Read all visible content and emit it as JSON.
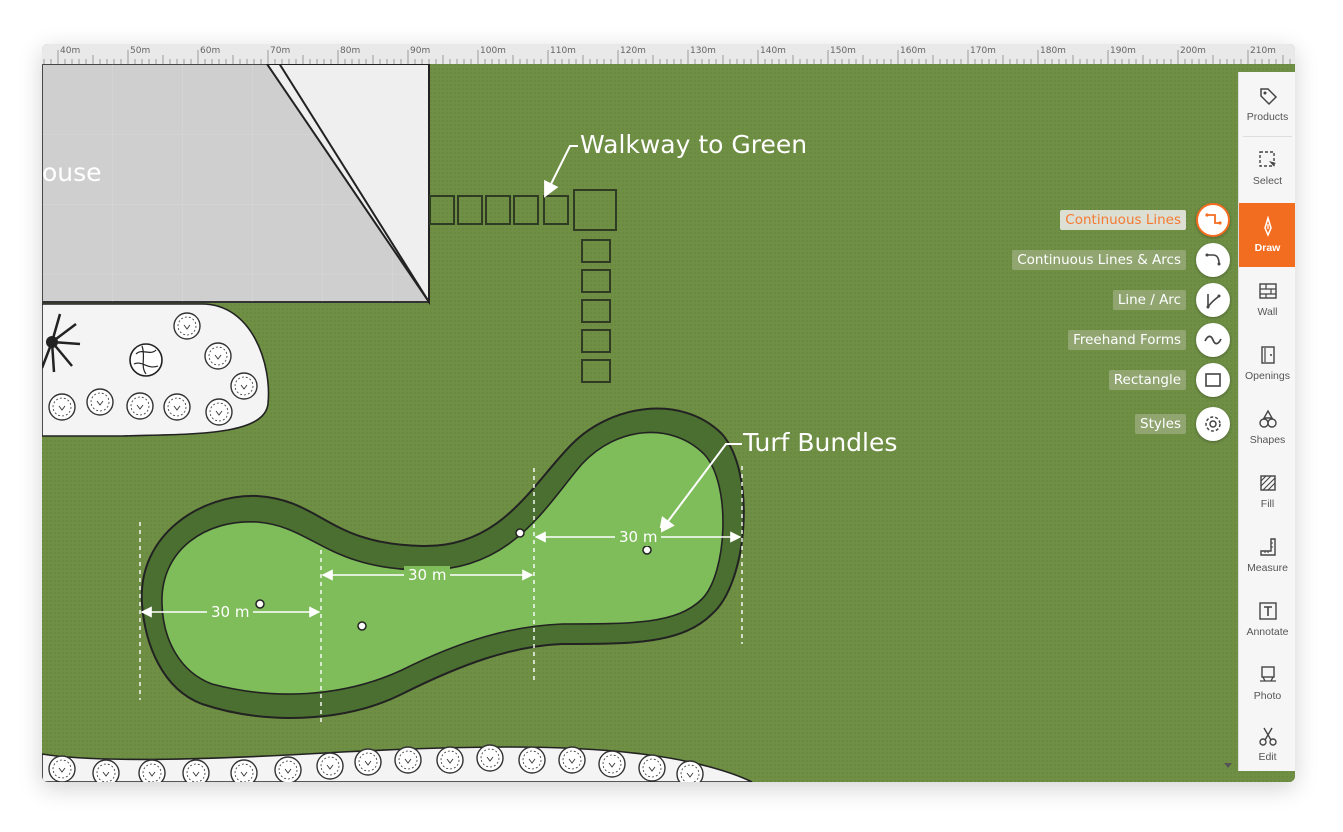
{
  "ruler": {
    "ticks": [
      "40m",
      "50m",
      "60m",
      "70m",
      "80m",
      "90m",
      "100m",
      "110m",
      "120m",
      "130m",
      "140m",
      "150m",
      "160m",
      "170m",
      "180m",
      "190m",
      "200m",
      "210m"
    ]
  },
  "canvas": {
    "house_label": "ouse",
    "walkway_label": "Walkway to Green",
    "turf_label": "Turf Bundles",
    "dim_1": "30 m",
    "dim_2": "30 m",
    "dim_3": "30 m"
  },
  "draw_menu": {
    "items": [
      {
        "label": "Continuous Lines",
        "icon": "continuous-lines-icon",
        "active": true
      },
      {
        "label": "Continuous Lines & Arcs",
        "icon": "lines-arcs-icon",
        "active": false
      },
      {
        "label": "Line / Arc",
        "icon": "line-arc-icon",
        "active": false
      },
      {
        "label": "Freehand Forms",
        "icon": "freehand-icon",
        "active": false
      },
      {
        "label": "Rectangle",
        "icon": "rectangle-icon",
        "active": false
      },
      {
        "label": "Styles",
        "icon": "gear-icon",
        "active": false
      }
    ]
  },
  "toolbar": {
    "products": "Products",
    "select": "Select",
    "draw": "Draw",
    "wall": "Wall",
    "openings": "Openings",
    "shapes": "Shapes",
    "fill": "Fill",
    "measure": "Measure",
    "annotate": "Annotate",
    "photo": "Photo",
    "edit": "Edit"
  },
  "colors": {
    "accent": "#f36d21",
    "lawn": "#6f8f45",
    "green_inner": "#7fbd5b",
    "green_border": "#4a6f30"
  }
}
